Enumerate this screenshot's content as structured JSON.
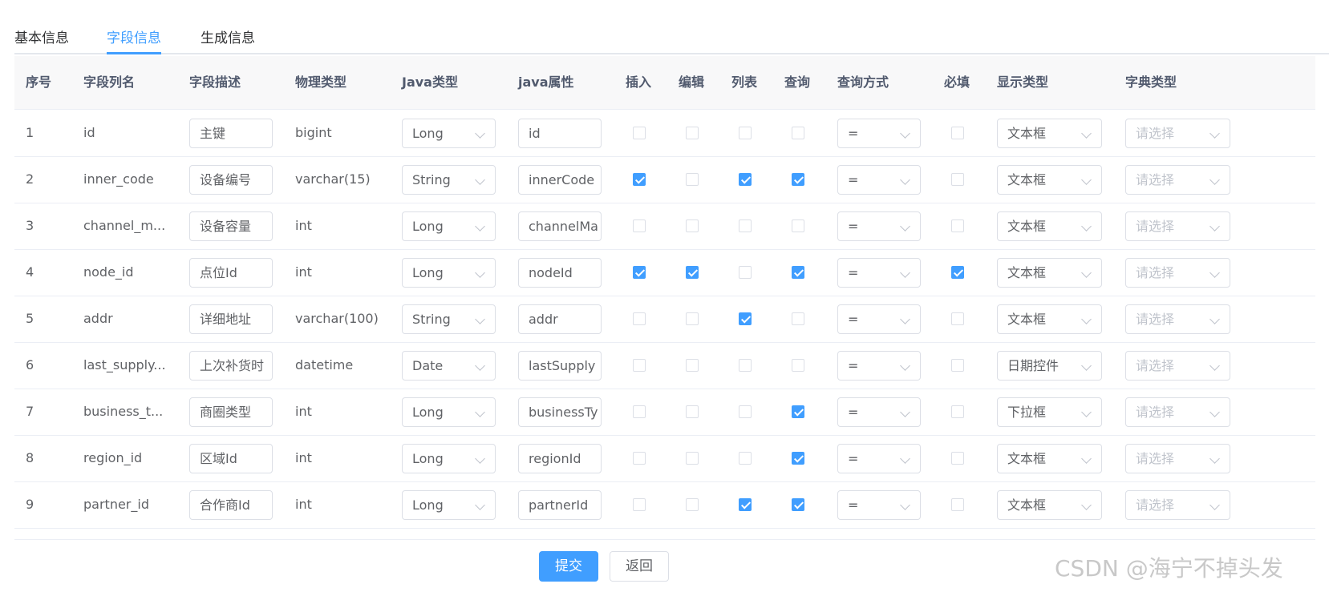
{
  "tabs": [
    {
      "label": "基本信息",
      "active": false
    },
    {
      "label": "字段信息",
      "active": true
    },
    {
      "label": "生成信息",
      "active": false
    }
  ],
  "columns": [
    "序号",
    "字段列名",
    "字段描述",
    "物理类型",
    "Java类型",
    "java属性",
    "插入",
    "编辑",
    "列表",
    "查询",
    "查询方式",
    "必填",
    "显示类型",
    "字典类型"
  ],
  "rows": [
    {
      "no": "1",
      "column": "id",
      "desc": "主键",
      "physical": "bigint",
      "javaType": "Long",
      "javaField": "id",
      "insert": false,
      "edit": false,
      "list": false,
      "query": false,
      "queryType": "=",
      "required": false,
      "htmlType": "文本框",
      "dictType": "请选择"
    },
    {
      "no": "2",
      "column": "inner_code",
      "desc": "设备编号",
      "physical": "varchar(15)",
      "javaType": "String",
      "javaField": "innerCode",
      "insert": true,
      "edit": false,
      "list": true,
      "query": true,
      "queryType": "=",
      "required": false,
      "htmlType": "文本框",
      "dictType": "请选择"
    },
    {
      "no": "3",
      "column": "channel_m...",
      "desc": "设备容量",
      "physical": "int",
      "javaType": "Long",
      "javaField": "channelMa",
      "insert": false,
      "edit": false,
      "list": false,
      "query": false,
      "queryType": "=",
      "required": false,
      "htmlType": "文本框",
      "dictType": "请选择"
    },
    {
      "no": "4",
      "column": "node_id",
      "desc": "点位Id",
      "physical": "int",
      "javaType": "Long",
      "javaField": "nodeId",
      "insert": true,
      "edit": true,
      "list": false,
      "query": true,
      "queryType": "=",
      "required": true,
      "htmlType": "文本框",
      "dictType": "请选择"
    },
    {
      "no": "5",
      "column": "addr",
      "desc": "详细地址",
      "physical": "varchar(100)",
      "javaType": "String",
      "javaField": "addr",
      "insert": false,
      "edit": false,
      "list": true,
      "query": false,
      "queryType": "=",
      "required": false,
      "htmlType": "文本框",
      "dictType": "请选择"
    },
    {
      "no": "6",
      "column": "last_supply...",
      "desc": "上次补货时",
      "physical": "datetime",
      "javaType": "Date",
      "javaField": "lastSupply",
      "insert": false,
      "edit": false,
      "list": false,
      "query": false,
      "queryType": "=",
      "required": false,
      "htmlType": "日期控件",
      "dictType": "请选择"
    },
    {
      "no": "7",
      "column": "business_t...",
      "desc": "商圈类型",
      "physical": "int",
      "javaType": "Long",
      "javaField": "businessTy",
      "insert": false,
      "edit": false,
      "list": false,
      "query": true,
      "queryType": "=",
      "required": false,
      "htmlType": "下拉框",
      "dictType": "请选择"
    },
    {
      "no": "8",
      "column": "region_id",
      "desc": "区域Id",
      "physical": "int",
      "javaType": "Long",
      "javaField": "regionId",
      "insert": false,
      "edit": false,
      "list": false,
      "query": true,
      "queryType": "=",
      "required": false,
      "htmlType": "文本框",
      "dictType": "请选择"
    },
    {
      "no": "9",
      "column": "partner_id",
      "desc": "合作商Id",
      "physical": "int",
      "javaType": "Long",
      "javaField": "partnerId",
      "insert": false,
      "edit": false,
      "list": true,
      "query": true,
      "queryType": "=",
      "required": false,
      "htmlType": "文本框",
      "dictType": "请选择"
    }
  ],
  "footer": {
    "submit_label": "提交",
    "back_label": "返回"
  },
  "watermark": "CSDN @海宁不掉头发",
  "colors": {
    "primary": "#409eff",
    "border": "#dcdfe6",
    "header_bg": "#f8f8f9"
  }
}
